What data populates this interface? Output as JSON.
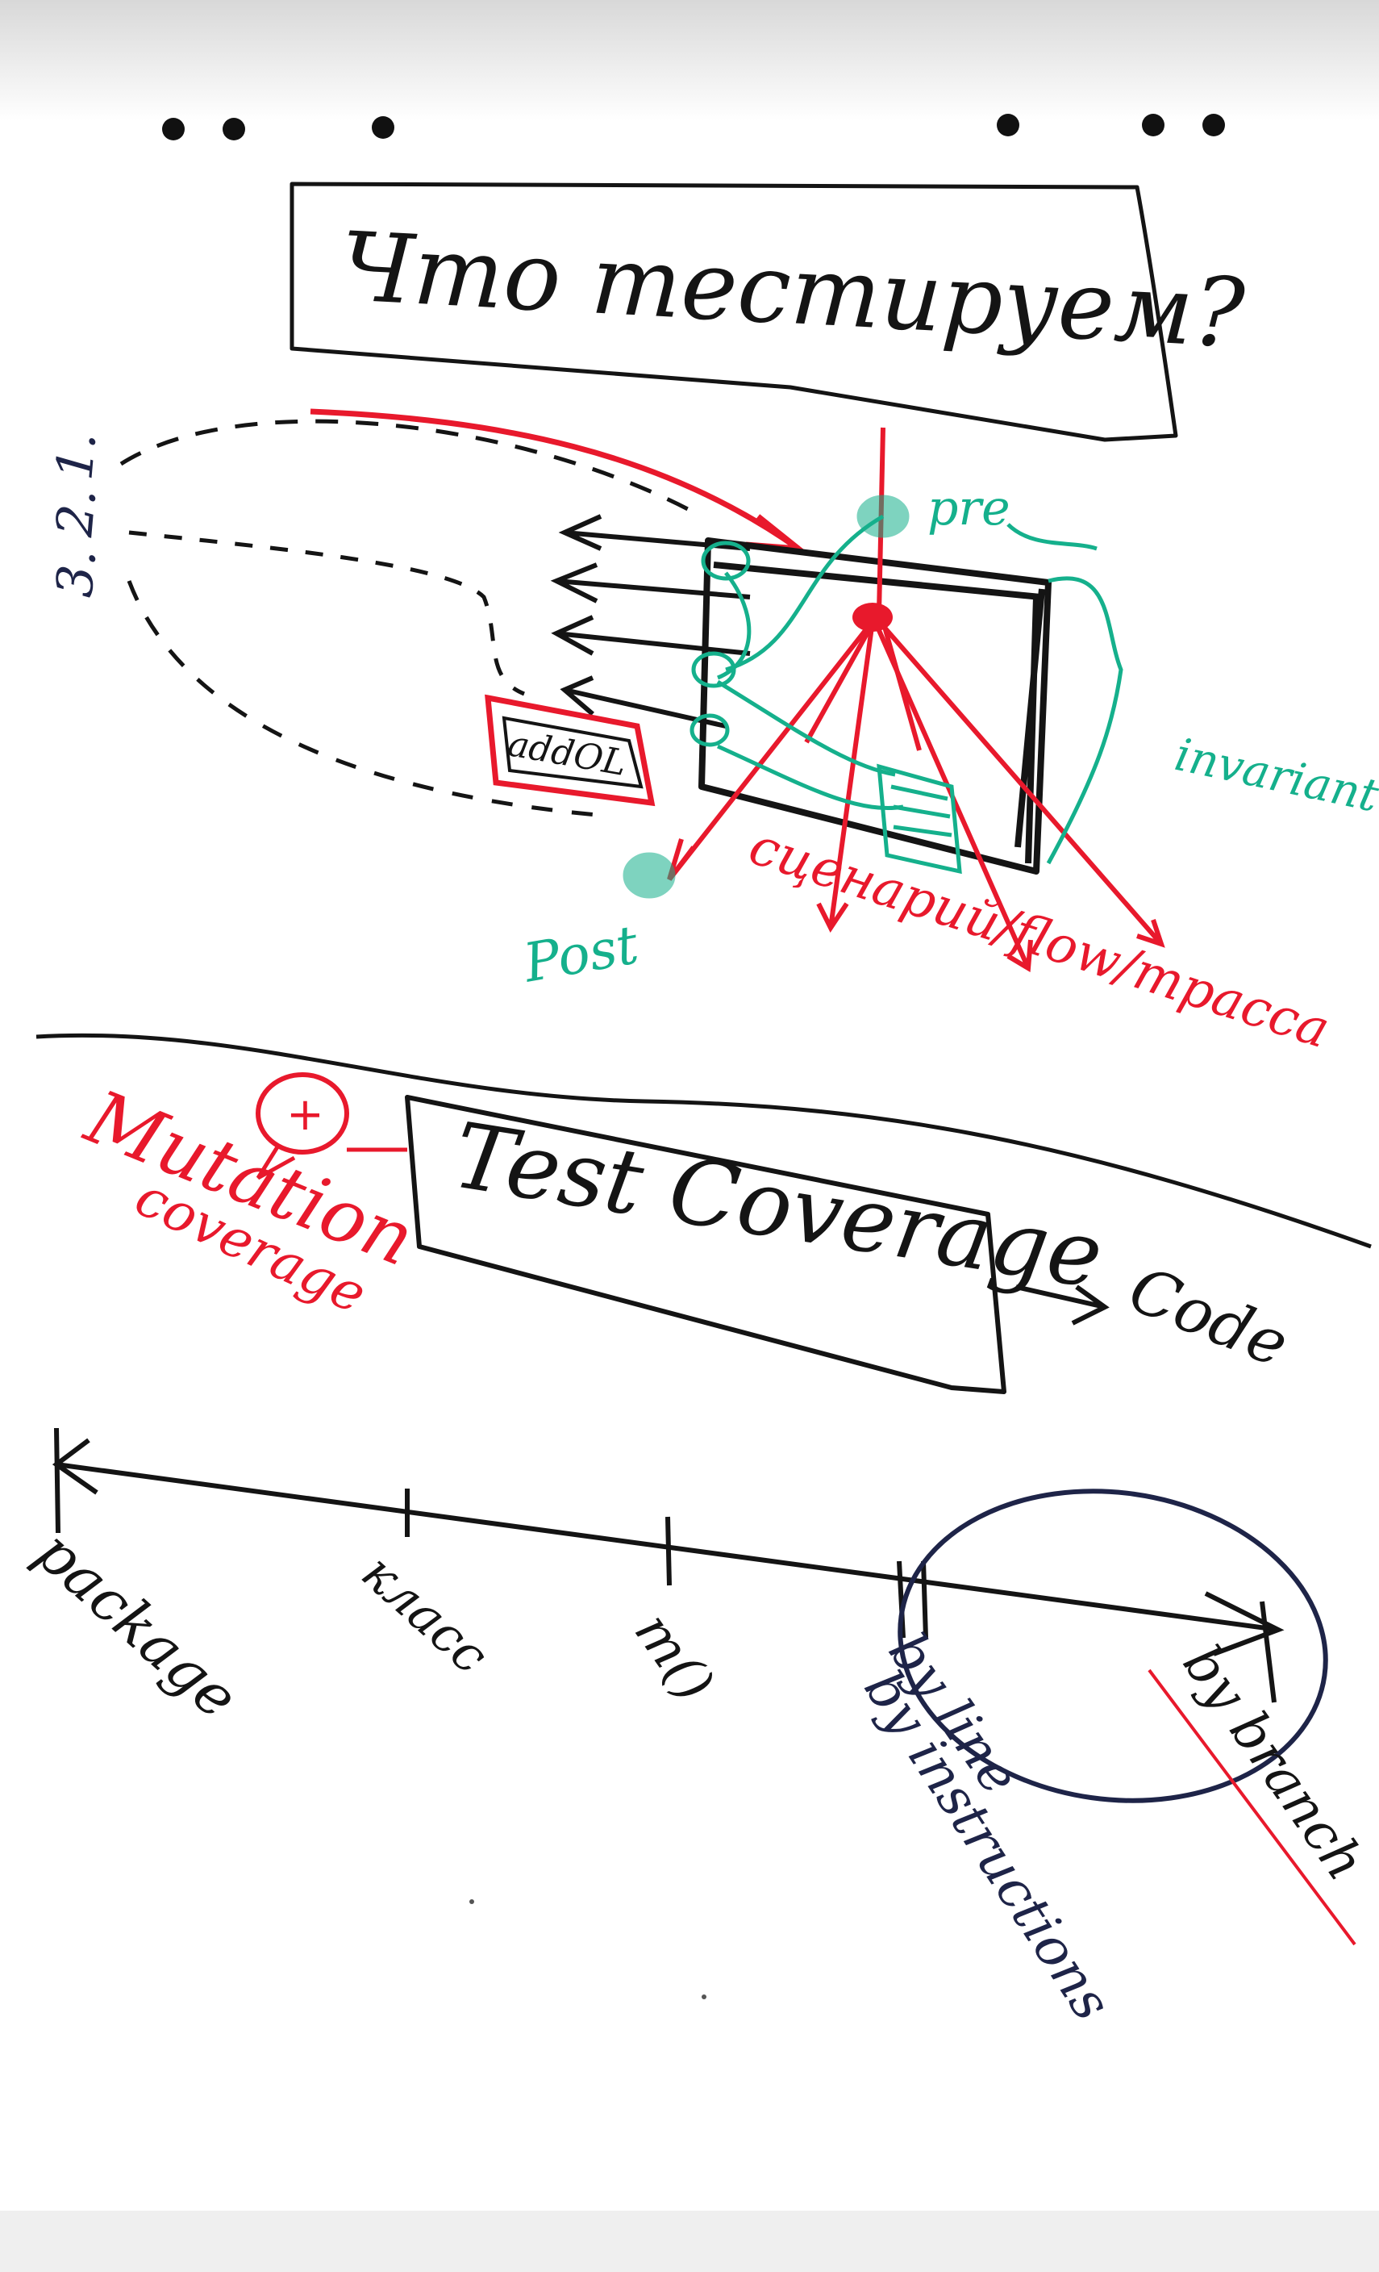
{
  "title": "Что тестируем?",
  "scenario": {
    "numbers": [
      "1.",
      "2.",
      "3."
    ],
    "box_label": "addOL",
    "pre_label": "pre",
    "post_label": "Post",
    "invariant_label": "invariant",
    "flow_label": "сценарий/flow/трасса"
  },
  "coverage": {
    "title": "Test Coverage",
    "code_label": "Code",
    "plus_symbol": "+",
    "mutation_label": "Mutation",
    "mutation_sub": "coverage"
  },
  "granularity": {
    "items": [
      "package",
      "класс",
      "m()",
      "by line",
      "by instructions",
      "by branch"
    ]
  },
  "colors": {
    "black": "#141414",
    "red": "#e8192c",
    "green": "#15b08c",
    "navy": "#1e2448"
  }
}
